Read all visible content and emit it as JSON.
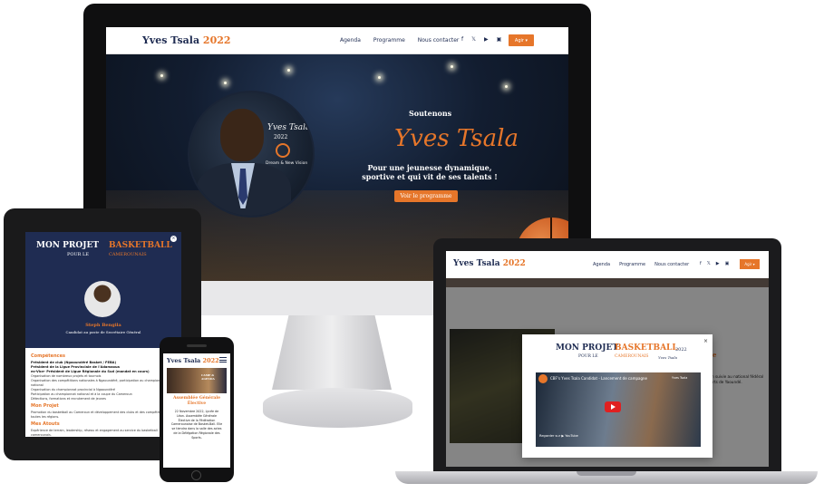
{
  "desktop": {
    "brand": "Yves Tsala",
    "brand_year": "2022",
    "nav": {
      "agenda": "Agenda",
      "programme": "Programme",
      "contact": "Nous contacter"
    },
    "social_icons": [
      "facebook-icon",
      "twitter-icon",
      "youtube-icon",
      "instagram-icon"
    ],
    "lang_button": "Agir ▾",
    "hero": {
      "kicker": "Soutenons",
      "name": "Yves Tsala",
      "tagline": "Pour une jeunesse dynamique, sportive et qui vit de ses talents !",
      "cta": "Voir le programme",
      "logo_script": "Yves Tsala",
      "logo_year": "2022",
      "logo_tag": "Dream & New Vision"
    }
  },
  "tablet": {
    "title_left": "MON PROJET",
    "title_right": "BASKETBALL",
    "title_year": "2022",
    "sub_left": "POUR LE",
    "sub_right": "CAMEROUNAIS",
    "person_name": "Steph Bengila",
    "person_role": "Candidat au poste de Secrétaire Général",
    "section_competences": "Compétences",
    "comp_lines": [
      "Président de club (Ngaoundéré Basket / FEBA)",
      "Président de la Ligue Provinciale de l'Adamaoua",
      "ex-Vice- Président de Ligue Régionale du Sud (mandat en cours)"
    ],
    "comp_bullets": [
      "Organisation de nombreux projets et tournois",
      "Organisation des compétitions nationales à Ngaoundéré, participation au championnat national",
      "Organisation du championnat provincial à Ngaoundéré",
      "Participation au championnat national et à la coupe du Cameroun",
      "Détections, formations et recrutement de jeunes"
    ],
    "section_projet": "Mon Projet",
    "projet_text": "Promotion du basketball au Cameroun et développement des clubs et des compétitions dans toutes les régions.",
    "section_atouts": "Mes Atouts",
    "atouts_text": "Expérience de terrain, leadership, réseau et engagement au service du basketball camerounais."
  },
  "phone": {
    "brand": "Yves Tsala",
    "brand_year": "2022",
    "image_caption": "CAMP & AGENDA",
    "headline": "Assemblée Générale Élective",
    "paragraph": "22 Novembre 2022, Lycée de Léon. Assemblée Générale Élective de la Fédération Camerounaise de Basket-Ball. Elle se tiendra dans la salle des actes de la Délégation Régionale des Sports."
  },
  "laptop": {
    "brand": "Yves Tsala",
    "brand_year": "2022",
    "nav": {
      "agenda": "Agenda",
      "programme": "Programme",
      "contact": "Nous contacter"
    },
    "lang_button": "Agir ▾",
    "bg_heading": "ce de",
    "bg_text": "une allocution suivie au national fédéral de la des Sports de Yaoundé.",
    "modal": {
      "close": "×",
      "title_left": "MON PROJET",
      "title_right": "BASKETBALL",
      "title_year": "2022",
      "sub_left": "POUR LE",
      "sub_right": "CAMEROUNAIS",
      "signature": "Yves Tsala",
      "video_title": "CBF's Yves Tsala Candidat - Lancement de campagne",
      "video_watch": "Regarder sur ▶ YouTube",
      "video_badge": "Yves Tsala"
    }
  },
  "colors": {
    "navy": "#1f2c52",
    "orange": "#e6762a"
  }
}
